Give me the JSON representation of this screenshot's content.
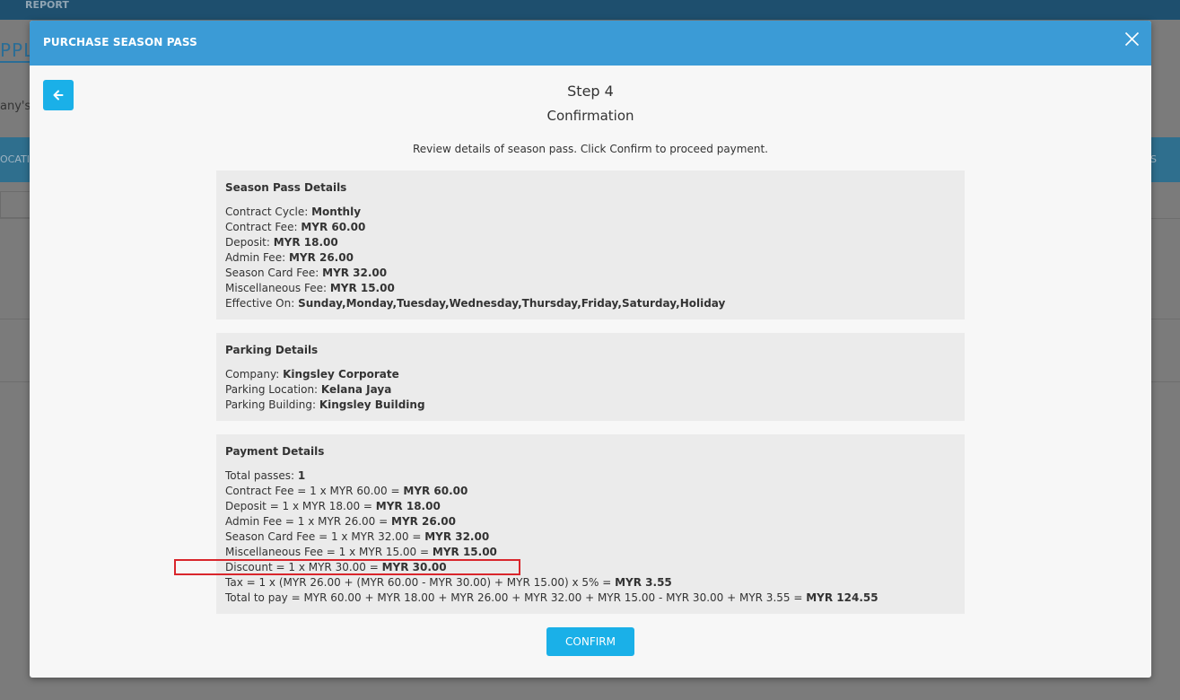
{
  "background": {
    "topbar_item": "REPORT",
    "title_fragment": "PPLI",
    "text_fragment": "any's s",
    "bar_left_fragment": "OCATIO",
    "bar_right_fragment": "S"
  },
  "modal": {
    "title": "PURCHASE SEASON PASS",
    "close_icon": "close-icon",
    "back_icon": "arrow-left-icon",
    "step": "Step 4",
    "step_name": "Confirmation",
    "instructions": "Review details of season pass. Click Confirm to proceed payment.",
    "confirm_label": "CONFIRM",
    "accent_color": "#3b9bd6",
    "button_color": "#1ab0e8",
    "highlight_color": "#d9262c"
  },
  "season_pass": {
    "title": "Season Pass Details",
    "rows": [
      {
        "label": "Contract Cycle:  ",
        "value": "Monthly"
      },
      {
        "label": "Contract Fee: ",
        "value": "MYR 60.00"
      },
      {
        "label": "Deposit: ",
        "value": "MYR 18.00"
      },
      {
        "label": "Admin Fee: ",
        "value": "MYR 26.00"
      },
      {
        "label": "Season Card Fee: ",
        "value": "MYR 32.00"
      },
      {
        "label": "Miscellaneous Fee: ",
        "value": "MYR 15.00"
      },
      {
        "label": "Effective On: ",
        "value": "Sunday,Monday,Tuesday,Wednesday,Thursday,Friday,Saturday,Holiday"
      }
    ]
  },
  "parking": {
    "title": "Parking Details",
    "rows": [
      {
        "label": "Company: ",
        "value": "Kingsley Corporate"
      },
      {
        "label": "Parking Location: ",
        "value": "Kelana Jaya"
      },
      {
        "label": "Parking Building: ",
        "value": "Kingsley Building"
      }
    ]
  },
  "payment": {
    "title": "Payment Details",
    "rows": [
      {
        "label": "Total passes: ",
        "value": "1"
      },
      {
        "label": "Contract Fee = 1 x MYR 60.00 = ",
        "value": "MYR 60.00"
      },
      {
        "label": "Deposit = 1 x MYR 18.00 = ",
        "value": "MYR 18.00"
      },
      {
        "label": "Admin Fee = 1 x MYR 26.00 = ",
        "value": "MYR 26.00"
      },
      {
        "label": "Season Card Fee = 1 x MYR 32.00 = ",
        "value": "MYR 32.00"
      },
      {
        "label": "Miscellaneous Fee = 1 x MYR 15.00 = ",
        "value": "MYR 15.00"
      },
      {
        "label": "Discount = 1 x MYR 30.00 = ",
        "value": "MYR 30.00"
      },
      {
        "label": "Tax = 1 x (MYR 26.00 + (MYR 60.00 - MYR 30.00) + MYR 15.00) x 5% = ",
        "value": "MYR 3.55"
      },
      {
        "label": "Total to pay  = MYR 60.00 + MYR 18.00 + MYR 26.00 + MYR 32.00 + MYR 15.00 - MYR 30.00 + MYR 3.55 =  ",
        "value": "MYR 124.55"
      }
    ]
  }
}
